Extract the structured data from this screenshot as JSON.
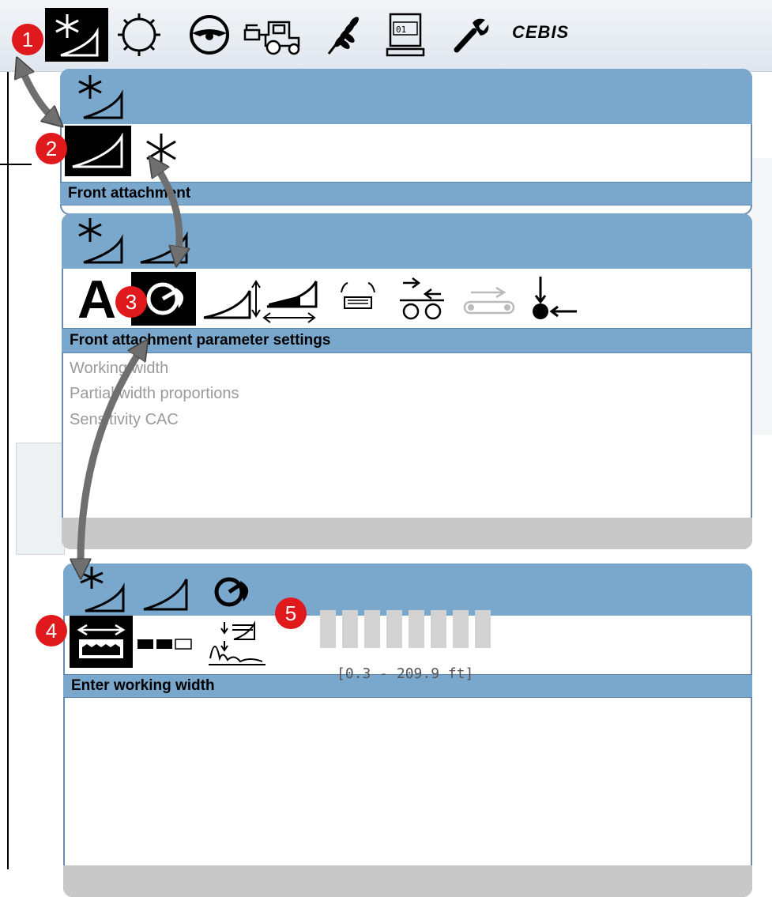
{
  "topbar": {
    "brand": "CEBIS",
    "icons": [
      "front-attachment-icon",
      "threshing-drum-icon",
      "steering-wheel-icon",
      "combine-harvester-icon",
      "grain-ear-icon",
      "counter-display-icon",
      "wrench-icon"
    ]
  },
  "panel1": {
    "title": "Front attachment"
  },
  "panel2": {
    "title": "Front attachment parameter settings",
    "items": [
      "Working width",
      "Partial width proportions",
      "Sensitivity CAC"
    ]
  },
  "panel3": {
    "title": "Enter working width",
    "range": "[0.3 - 209.9 ft]"
  },
  "badges": [
    "1",
    "2",
    "3",
    "4",
    "5"
  ],
  "colors": {
    "header_blue": "#7aa7cc",
    "badge_red": "#e0191c",
    "arrow_gray": "#6f6f6f"
  }
}
